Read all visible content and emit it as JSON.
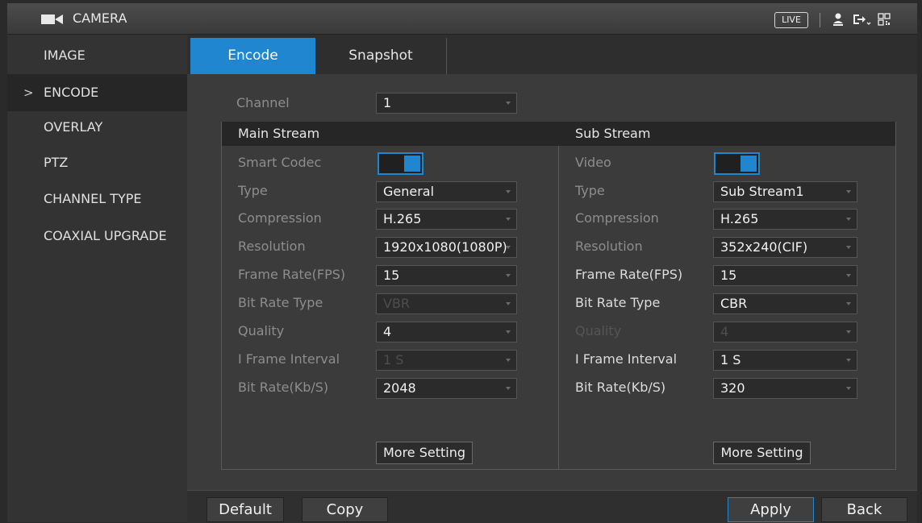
{
  "titlebar": {
    "title": "CAMERA",
    "live_label": "LIVE",
    "icons": [
      "camera-icon",
      "user-icon",
      "logout-icon",
      "qr-code-icon"
    ]
  },
  "sidebar": {
    "items": [
      {
        "label": "IMAGE",
        "active": false
      },
      {
        "label": "ENCODE",
        "active": true,
        "chevron": ">"
      },
      {
        "label": "OVERLAY",
        "active": false
      },
      {
        "label": "PTZ",
        "active": false
      },
      {
        "label": "CHANNEL TYPE",
        "active": false
      },
      {
        "label": "COAXIAL UPGRADE",
        "active": false
      }
    ]
  },
  "tabs": [
    {
      "label": "Encode",
      "active": true
    },
    {
      "label": "Snapshot",
      "active": false
    }
  ],
  "channel": {
    "label": "Channel",
    "value": "1"
  },
  "main_stream": {
    "title": "Main Stream",
    "smart_codec_label": "Smart Codec",
    "smart_codec_on": true,
    "type_label": "Type",
    "type_value": "General",
    "compression_label": "Compression",
    "compression_value": "H.265",
    "resolution_label": "Resolution",
    "resolution_value": "1920x1080(1080P)",
    "frame_rate_label": "Frame Rate(FPS)",
    "frame_rate_value": "15",
    "bit_rate_type_label": "Bit Rate Type",
    "bit_rate_type_value": "VBR",
    "quality_label": "Quality",
    "quality_value": "4",
    "iframe_label": "I Frame Interval",
    "iframe_value": "1 S",
    "bit_rate_label": "Bit Rate(Kb/S)",
    "bit_rate_value": "2048",
    "more_setting": "More Setting"
  },
  "sub_stream": {
    "title": "Sub Stream",
    "video_label": "Video",
    "video_on": true,
    "type_label": "Type",
    "type_value": "Sub Stream1",
    "compression_label": "Compression",
    "compression_value": "H.265",
    "resolution_label": "Resolution",
    "resolution_value": "352x240(CIF)",
    "frame_rate_label": "Frame Rate(FPS)",
    "frame_rate_value": "15",
    "bit_rate_type_label": "Bit Rate Type",
    "bit_rate_type_value": "CBR",
    "quality_label": "Quality",
    "quality_value": "4",
    "iframe_label": "I Frame Interval",
    "iframe_value": "1 S",
    "bit_rate_label": "Bit Rate(Kb/S)",
    "bit_rate_value": "320",
    "more_setting": "More Setting"
  },
  "footer": {
    "default": "Default",
    "copy": "Copy",
    "apply": "Apply",
    "back": "Back"
  },
  "colors": {
    "accent": "#1f86cf",
    "background": "#3b3b3b",
    "sidebar": "#333333"
  }
}
